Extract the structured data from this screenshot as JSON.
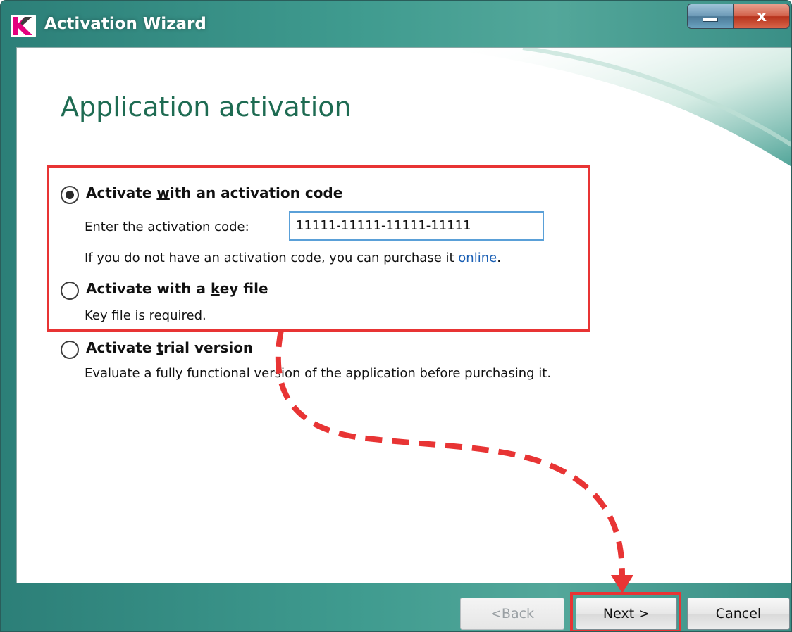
{
  "window": {
    "title": "Activation Wizard",
    "close_glyph": "x"
  },
  "page": {
    "title": "Application activation"
  },
  "options": [
    {
      "pre": "Activate ",
      "accel": "w",
      "post": "ith an activation code",
      "selected": true
    },
    {
      "pre": "Activate with a ",
      "accel": "k",
      "post": "ey file",
      "selected": false
    },
    {
      "pre": "Activate ",
      "accel": "t",
      "post": "rial version",
      "selected": false
    }
  ],
  "code": {
    "label": "Enter the activation code:",
    "value": "11111-11111-11111-11111",
    "purchase_text": "If you do not have an activation code, you can purchase it ",
    "link": "online",
    "purchase_end": "."
  },
  "key_file_note": "Key file is required.",
  "trial_note": "Evaluate a fully functional version of the application before purchasing it.",
  "buttons": {
    "back": {
      "pre": "< ",
      "accel": "B",
      "post": "ack"
    },
    "next": {
      "pre": "",
      "accel": "N",
      "post": "ext >"
    },
    "cancel": {
      "pre": "",
      "accel": "C",
      "post": "ancel"
    }
  },
  "icons": {
    "app": "kaspersky-k-logo",
    "minimize": "minimize-icon",
    "close": "close-icon"
  },
  "colors": {
    "title_green": "#1e6b52",
    "annotation_red": "#e83434",
    "link_blue": "#1a5fb4",
    "frame_teal": "#3f9b8f"
  }
}
